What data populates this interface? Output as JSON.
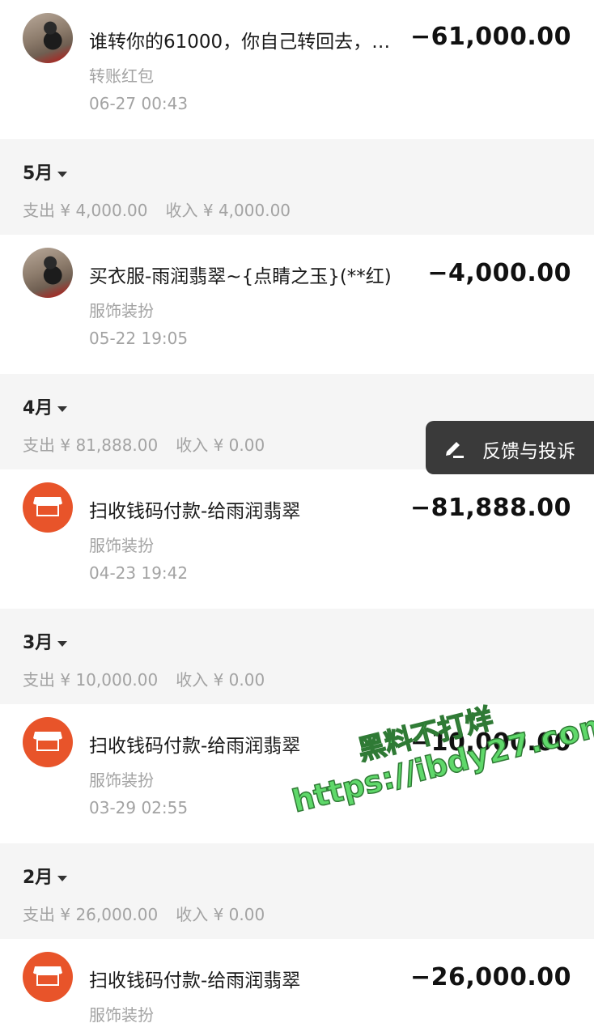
{
  "transactions": [
    {
      "title": "谁转你的61000，你自己转回去，…",
      "category": "转账红包",
      "time": "06-27  00:43",
      "amount": "−61,000.00",
      "avatar": "photo"
    },
    {
      "title": "买衣服-雨润翡翠~{点睛之玉}(**红)",
      "category": "服饰装扮",
      "time": "05-22  19:05",
      "amount": "−4,000.00",
      "avatar": "photo"
    },
    {
      "title": "扫收钱码付款-给雨润翡翠",
      "category": "服饰装扮",
      "time": "04-23  19:42",
      "amount": "−81,888.00",
      "avatar": "shop-icon"
    },
    {
      "title": "扫收钱码付款-给雨润翡翠",
      "category": "服饰装扮",
      "time": "03-29  02:55",
      "amount": "−10,000.00",
      "avatar": "shop-icon"
    },
    {
      "title": "扫收钱码付款-给雨润翡翠",
      "category": "服饰装扮",
      "time": "",
      "amount": "−26,000.00",
      "avatar": "shop-icon"
    }
  ],
  "months": [
    {
      "label": "5月",
      "expense": "支出 ¥ 4,000.00",
      "income": "收入 ¥ 4,000.00"
    },
    {
      "label": "4月",
      "expense": "支出 ¥ 81,888.00",
      "income": "收入 ¥ 0.00"
    },
    {
      "label": "3月",
      "expense": "支出 ¥ 10,000.00",
      "income": "收入 ¥ 0.00"
    },
    {
      "label": "2月",
      "expense": "支出 ¥ 26,000.00",
      "income": "收入 ¥ 0.00"
    }
  ],
  "feedback": {
    "label": "反馈与投诉",
    "icon": "edit-icon"
  },
  "watermark": {
    "line1": "黑料不打烊",
    "line2": "https://ibdy27.com"
  },
  "colors": {
    "shop_orange": "#e8542a",
    "watermark_green": "#5fd86a",
    "feedback_bg": "#3a3a3a"
  }
}
